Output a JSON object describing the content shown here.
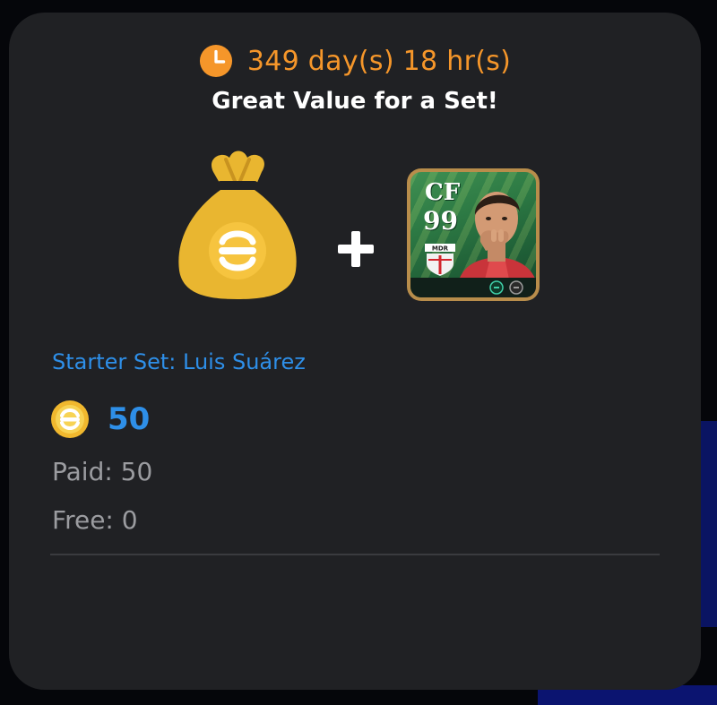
{
  "offer": {
    "timer_text": "349 day(s) 18 hr(s)",
    "headline": "Great Value for a Set!",
    "set_title": "Starter Set: Luis Suárez",
    "price": "50",
    "paid_line": "Paid: 50",
    "free_line": "Free: 0"
  },
  "player_card": {
    "position": "CF",
    "rating": "99",
    "club_badge": "MDR"
  },
  "icons": {
    "timer": "clock-icon",
    "coin_bag": "coin-bag-icon",
    "plus": "plus-icon",
    "coin": "efootball-coin-icon"
  },
  "colors": {
    "timer": "#f5962a",
    "accent_blue": "#2e8fe8",
    "card_bg": "#202124",
    "muted_text": "#9b9ca0",
    "gold": "#e9b630"
  }
}
